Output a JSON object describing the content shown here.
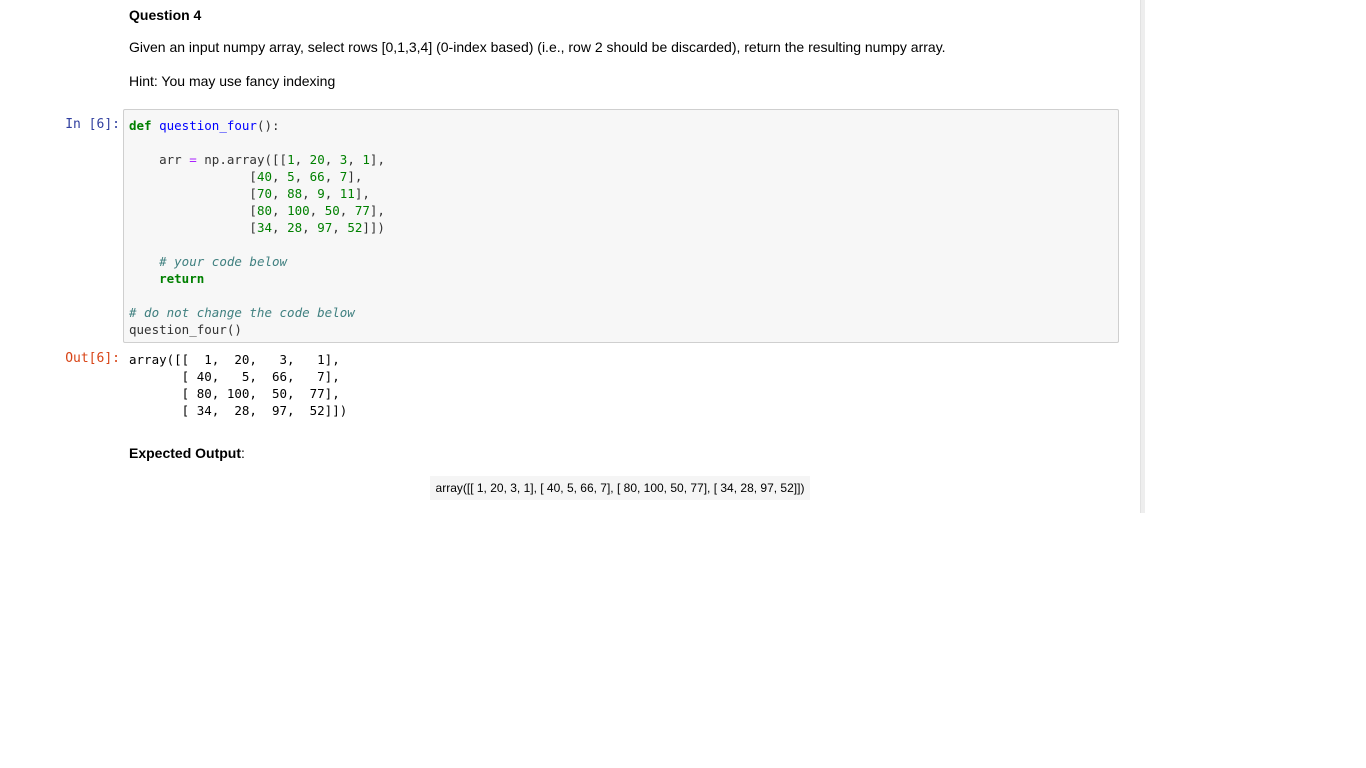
{
  "markdown": {
    "title": "Question 4",
    "description": "Given an input numpy array, select rows [0,1,3,4] (0-index based) (i.e., row 2 should be discarded), return the resulting numpy array.",
    "hint": "Hint: You may use fancy indexing"
  },
  "code_cell": {
    "in_prompt": "In [6]:",
    "out_prompt": "Out[6]:",
    "code": {
      "l1_kw": "def",
      "l1_fn": "question_four",
      "l1_rest": "():",
      "l3_indent": "    ",
      "l3_var": "arr",
      "l3_op": "=",
      "l3_call": "np.array([[",
      "row0": [
        "1",
        "20",
        "3",
        "1"
      ],
      "row1": [
        "40",
        "5",
        "66",
        "7"
      ],
      "row2": [
        "70",
        "88",
        "9",
        "11"
      ],
      "row3": [
        "80",
        "100",
        "50",
        "77"
      ],
      "row4": [
        "34",
        "28",
        "97",
        "52"
      ],
      "comment1": "# your code below",
      "return_kw": "return",
      "comment2": "# do not change the code below",
      "call": "question_four()"
    },
    "output": [
      "array([[  1,  20,   3,   1],",
      "       [ 40,   5,  66,   7],",
      "       [ 80, 100,  50,  77],",
      "       [ 34,  28,  97,  52]])"
    ]
  },
  "expected": {
    "label": "Expected Output",
    "label_suffix": ":",
    "value": "array([[ 1, 20, 3, 1], [ 40, 5, 66, 7], [ 80, 100, 50, 77], [ 34, 28, 97, 52]])"
  }
}
